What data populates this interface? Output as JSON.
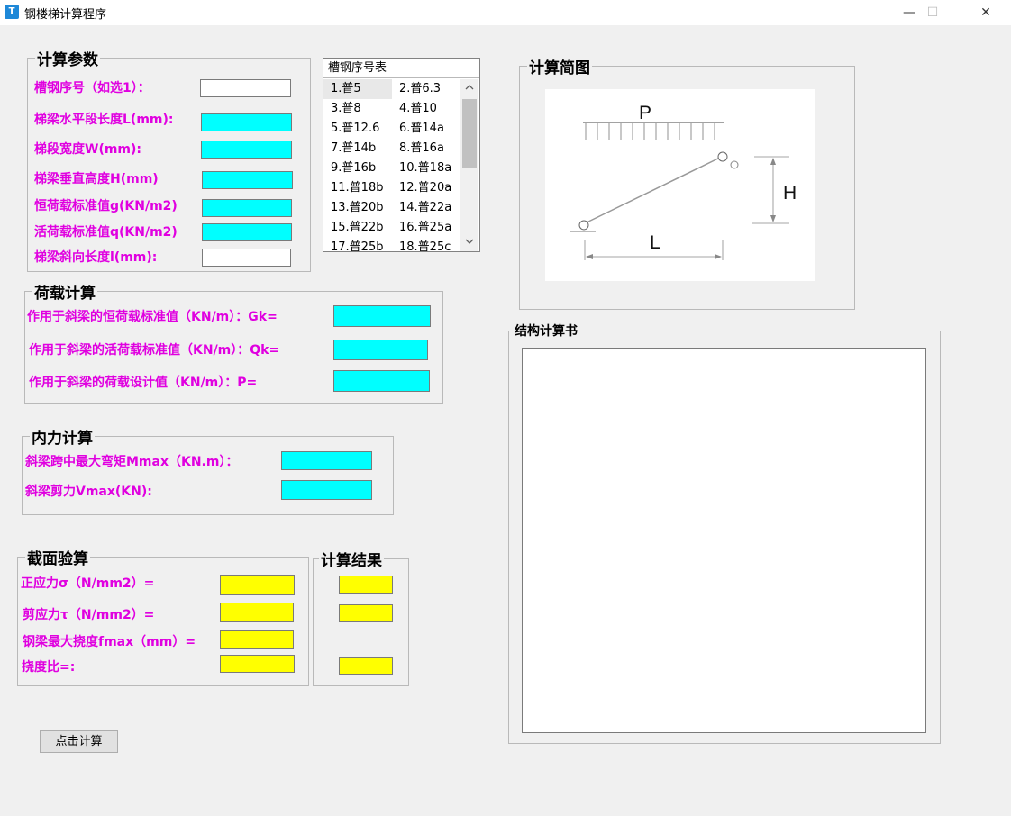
{
  "window": {
    "title": "钢楼梯计算程序",
    "icon_text": "T",
    "minimize": "—",
    "maximize": "☐",
    "close": "✕"
  },
  "params": {
    "legend": "计算参数",
    "channel_no": {
      "label": "槽钢序号（如选1）：",
      "value": ""
    },
    "L": {
      "label": "梯梁水平段长度L(mm):",
      "value": ""
    },
    "W": {
      "label": "梯段宽度W(mm):",
      "value": ""
    },
    "H": {
      "label": "梯梁垂直高度H(mm)",
      "value": ""
    },
    "g": {
      "label": "恒荷载标准值g(KN/m2)",
      "value": ""
    },
    "q": {
      "label": "活荷载标准值q(KN/m2)",
      "value": ""
    },
    "l": {
      "label": "梯梁斜向长度l(mm):",
      "value": ""
    }
  },
  "channel_table": {
    "title": "槽钢序号表",
    "rows": [
      [
        "1.普5",
        "2.普6.3"
      ],
      [
        "3.普8",
        "4.普10"
      ],
      [
        "5.普12.6",
        "6.普14a"
      ],
      [
        "7.普14b",
        "8.普16a"
      ],
      [
        "9.普16b",
        "10.普18a"
      ],
      [
        "11.普18b",
        "12.普20a"
      ],
      [
        "13.普20b",
        "14.普22a"
      ],
      [
        "15.普22b",
        "16.普25a"
      ],
      [
        "17.普25b",
        "18.普25c"
      ]
    ]
  },
  "load": {
    "legend": "荷载计算",
    "Gk": {
      "label": "作用于斜梁的恒荷载标准值（KN/m）：Gk=",
      "value": ""
    },
    "Qk": {
      "label": "作用于斜梁的活荷载标准值（KN/m）：Qk=",
      "value": ""
    },
    "P": {
      "label": "作用于斜梁的荷载设计值（KN/m）：P=",
      "value": ""
    }
  },
  "internal": {
    "legend": "内力计算",
    "Mmax": {
      "label": "斜梁跨中最大弯矩Mmax（KN.m）：",
      "value": ""
    },
    "Vmax": {
      "label": "斜梁剪力Vmax(KN):",
      "value": ""
    }
  },
  "section": {
    "legend": "截面验算",
    "sigma": {
      "label": "正应力σ（N/mm2）=",
      "value": ""
    },
    "tau": {
      "label": "剪应力τ（N/mm2）=",
      "value": ""
    },
    "fmax": {
      "label": "钢梁最大挠度fmax（mm）=",
      "value": ""
    },
    "ratio": {
      "label": "挠度比=:",
      "value": ""
    }
  },
  "result": {
    "legend": "计算结果",
    "values": [
      "",
      "",
      ""
    ]
  },
  "calc_button": "点击计算",
  "sketch": {
    "legend": "计算简图",
    "P": "P",
    "H": "H",
    "L": "L"
  },
  "report": {
    "legend": "结构计算书",
    "text": ""
  },
  "colors": {
    "accent_label": "#e000e0",
    "input_cyan": "#00ffff",
    "input_yellow": "#ffff00"
  }
}
